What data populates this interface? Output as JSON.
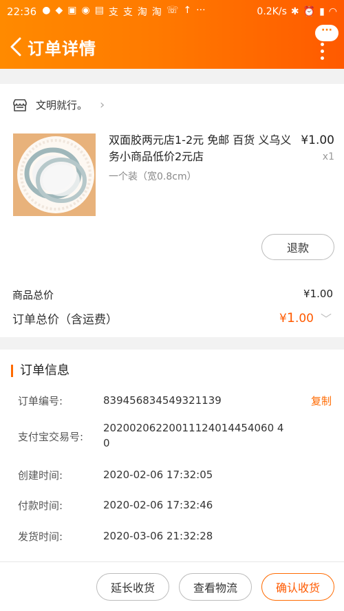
{
  "status": {
    "time": "22:36",
    "speed": "0.2K/s",
    "left_icons": [
      "wechat-icon",
      "water-drop-icon",
      "app-icon",
      "weibo-icon",
      "mi-icon",
      "alipay-icon",
      "alipay-icon",
      "taobao-icon",
      "taobao-icon",
      "phone-missed-icon",
      "upload-icon",
      "more-dots-icon"
    ],
    "right_icons": [
      "bluetooth-icon",
      "alarm-icon",
      "signal-icon",
      "wifi-icon"
    ]
  },
  "header": {
    "title": "订单详情",
    "more_badge": "···"
  },
  "shop": {
    "name": "文明就行。"
  },
  "product": {
    "title": "双面胶两元店1-2元 免邮 百货 义乌义务小商品低价2元店",
    "spec": "一个装（宽0.8cm）",
    "price": "¥1.00",
    "qty": "x1",
    "refund_label": "退款"
  },
  "totals": {
    "goods_label": "商品总价",
    "goods_value": "¥1.00",
    "order_label": "订单总价（含运费）",
    "order_currency": "¥",
    "order_int": "1",
    "order_dec": ".00"
  },
  "order_info": {
    "title": "订单信息",
    "copy_label": "复制",
    "rows": [
      {
        "label": "订单编号:",
        "value": "839456834549321139"
      },
      {
        "label": "支付宝交易号:",
        "value": "20200206220011124014454060 40"
      },
      {
        "label": "创建时间:",
        "value": "2020-02-06 17:32:05"
      },
      {
        "label": "付款时间:",
        "value": "2020-02-06 17:32:46"
      },
      {
        "label": "发货时间:",
        "value": "2020-03-06 21:32:28"
      }
    ]
  },
  "actions": {
    "extend": "延长收货",
    "track": "查看物流",
    "confirm": "确认收货"
  },
  "colors": {
    "accent": "#ff6a00",
    "header_start": "#ff8a00",
    "header_end": "#ff5a00"
  }
}
